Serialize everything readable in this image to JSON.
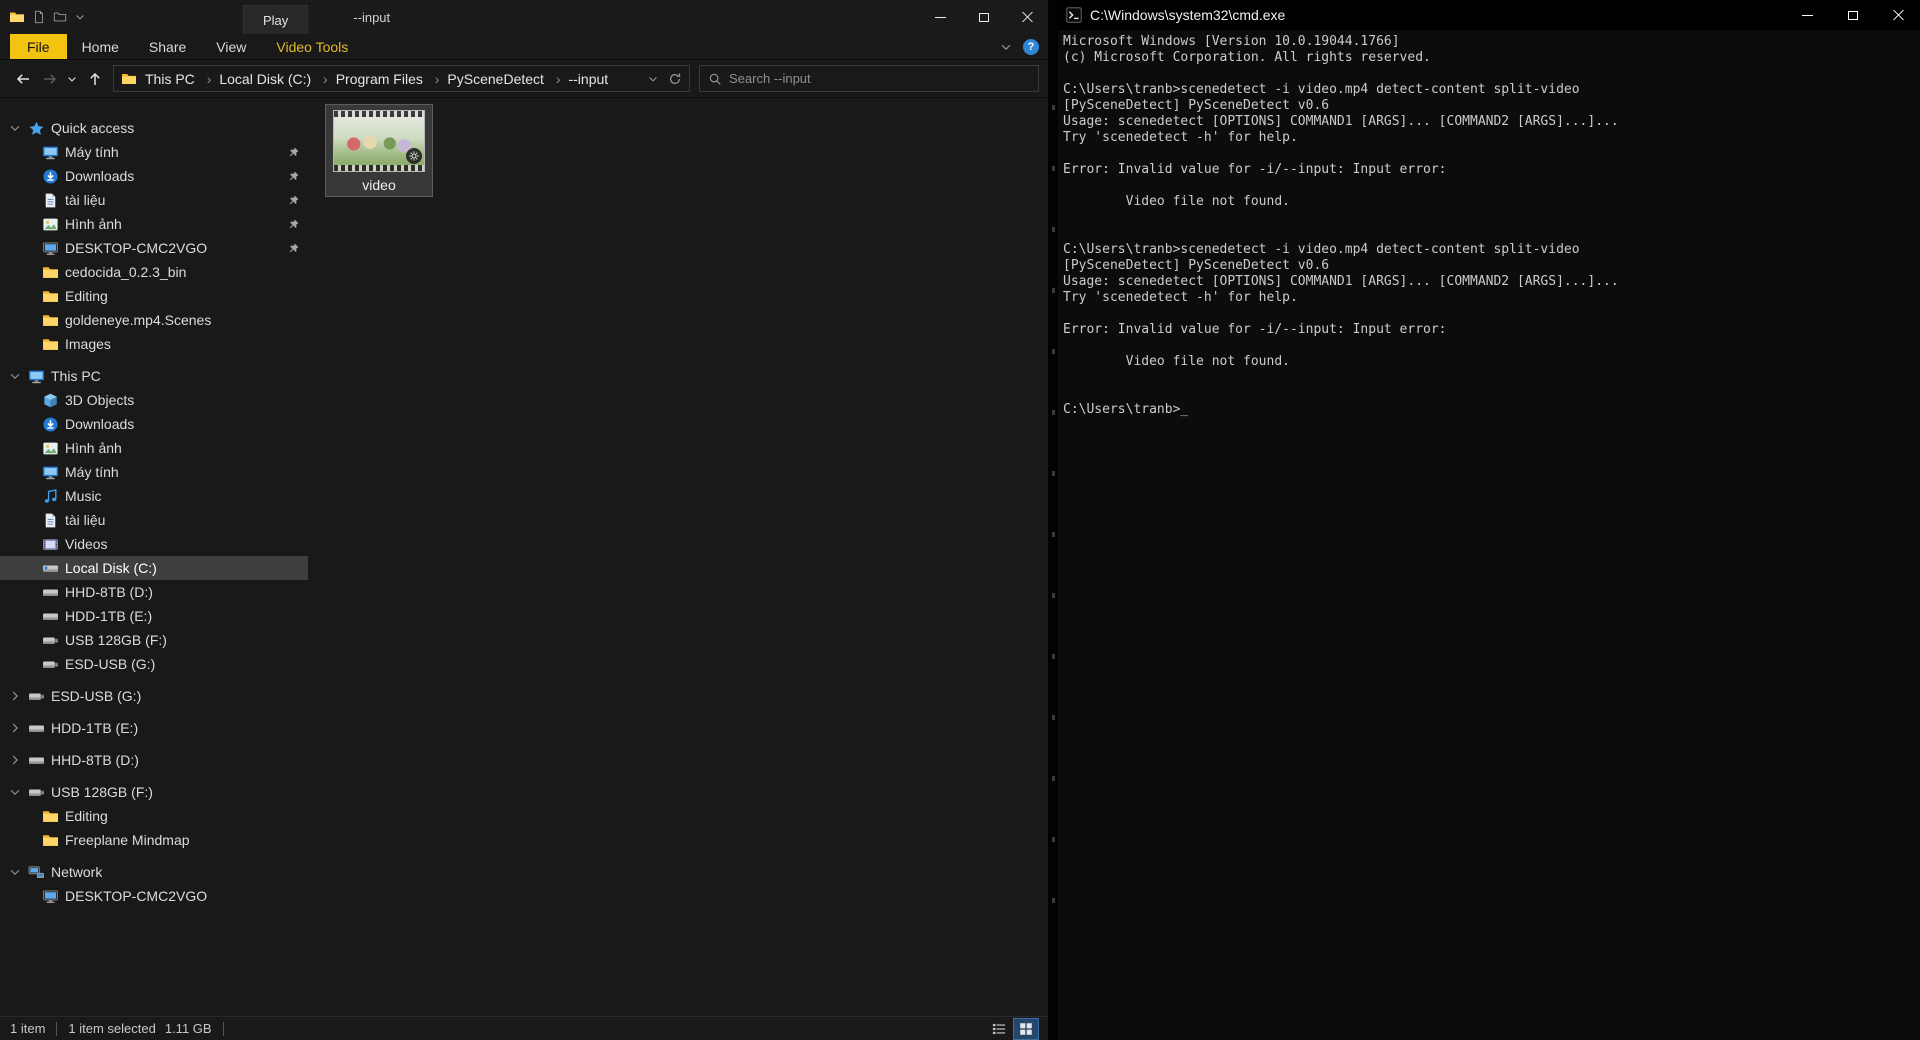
{
  "explorer": {
    "window": {
      "contextual_tab": "Play",
      "title": "--input"
    },
    "help_glyph": "?",
    "ribbon_tabs": [
      {
        "label": "File",
        "accent": true
      },
      {
        "label": "Home"
      },
      {
        "label": "Share"
      },
      {
        "label": "View"
      },
      {
        "label": "Video Tools",
        "contextual": true
      }
    ],
    "breadcrumb": [
      {
        "label": "This PC"
      },
      {
        "label": "Local Disk (C:)"
      },
      {
        "label": "Program Files"
      },
      {
        "label": "PySceneDetect"
      },
      {
        "label": "--input"
      }
    ],
    "nav": {
      "search_placeholder": "Search --input"
    },
    "sidebar_items": [
      {
        "label": "Quick access",
        "icon": "star",
        "chevron": "chevron-down",
        "level": 0
      },
      {
        "label": "Máy tính",
        "icon": "monitor",
        "level": 1,
        "pin": "pin"
      },
      {
        "label": "Downloads",
        "icon": "download",
        "level": 1,
        "pin": "pin"
      },
      {
        "label": "tài liệu",
        "icon": "document",
        "level": 1,
        "pin": "pin"
      },
      {
        "label": "Hình ảnh",
        "icon": "image",
        "level": 1,
        "pin": "pin"
      },
      {
        "label": "DESKTOP-CMC2VGO",
        "icon": "network-pc",
        "level": 1,
        "pin": "pin"
      },
      {
        "label": "cedocida_0.2.3_bin",
        "icon": "folder",
        "level": 1
      },
      {
        "label": "Editing",
        "icon": "folder",
        "level": 1
      },
      {
        "label": "goldeneye.mp4.Scenes",
        "icon": "folder",
        "level": 1
      },
      {
        "label": "Images",
        "icon": "folder",
        "level": 1
      },
      {
        "label": "This PC",
        "icon": "monitor",
        "chevron": "chevron-down",
        "level": 0,
        "gap_before": true
      },
      {
        "label": "3D Objects",
        "icon": "cube",
        "level": 1
      },
      {
        "label": "Downloads",
        "icon": "download",
        "level": 1
      },
      {
        "label": "Hình ảnh",
        "icon": "image",
        "level": 1
      },
      {
        "label": "Máy tính",
        "icon": "monitor",
        "level": 1
      },
      {
        "label": "Music",
        "icon": "music",
        "level": 1
      },
      {
        "label": "tài liệu",
        "icon": "document",
        "level": 1
      },
      {
        "label": "Videos",
        "icon": "video",
        "level": 1
      },
      {
        "label": "Local Disk (C:)",
        "icon": "drive-c",
        "level": 1,
        "selected": true
      },
      {
        "label": "HHD-8TB (D:)",
        "icon": "drive",
        "level": 1
      },
      {
        "label": "HDD-1TB (E:)",
        "icon": "drive",
        "level": 1
      },
      {
        "label": "USB 128GB (F:)",
        "icon": "drive-usb",
        "level": 1
      },
      {
        "label": "ESD-USB (G:)",
        "icon": "drive-usb",
        "level": 1
      },
      {
        "label": "ESD-USB (G:)",
        "icon": "drive-usb",
        "chevron": "chevron-right",
        "level": 0,
        "gap_before": true
      },
      {
        "label": "HDD-1TB (E:)",
        "icon": "drive",
        "chevron": "chevron-right",
        "level": 0,
        "gap_before": true
      },
      {
        "label": "HHD-8TB (D:)",
        "icon": "drive",
        "chevron": "chevron-right",
        "level": 0,
        "gap_before": true
      },
      {
        "label": "USB 128GB (F:)",
        "icon": "drive-usb",
        "chevron": "chevron-down",
        "level": 0,
        "gap_before": true
      },
      {
        "label": "Editing",
        "icon": "folder",
        "level": 1
      },
      {
        "label": "Freeplane Mindmap",
        "icon": "folder",
        "level": 1
      },
      {
        "label": "Network",
        "icon": "network",
        "chevron": "chevron-down",
        "level": 0,
        "gap_before": true
      },
      {
        "label": "DESKTOP-CMC2VGO",
        "icon": "network-pc",
        "level": 1
      }
    ],
    "files": [
      {
        "name": "video",
        "selected": true
      }
    ],
    "statusbar": {
      "count": "1 item",
      "selected": "1 item selected",
      "size": "1.11 GB"
    }
  },
  "cmd": {
    "title": "C:\\Windows\\system32\\cmd.exe",
    "console_text": "Microsoft Windows [Version 10.0.19044.1766]\n(c) Microsoft Corporation. All rights reserved.\n\nC:\\Users\\tranb>scenedetect -i video.mp4 detect-content split-video\n[PySceneDetect] PySceneDetect v0.6\nUsage: scenedetect [OPTIONS] COMMAND1 [ARGS]... [COMMAND2 [ARGS]...]...\nTry 'scenedetect -h' for help.\n\nError: Invalid value for -i/--input: Input error:\n\n        Video file not found.\n\n\nC:\\Users\\tranb>scenedetect -i video.mp4 detect-content split-video\n[PySceneDetect] PySceneDetect v0.6\nUsage: scenedetect [OPTIONS] COMMAND1 [ARGS]... [COMMAND2 [ARGS]...]...\nTry 'scenedetect -h' for help.\n\nError: Invalid value for -i/--input: Input error:\n\n        Video file not found.\n\n\nC:\\Users\\tranb>",
    "cursor": "_"
  }
}
